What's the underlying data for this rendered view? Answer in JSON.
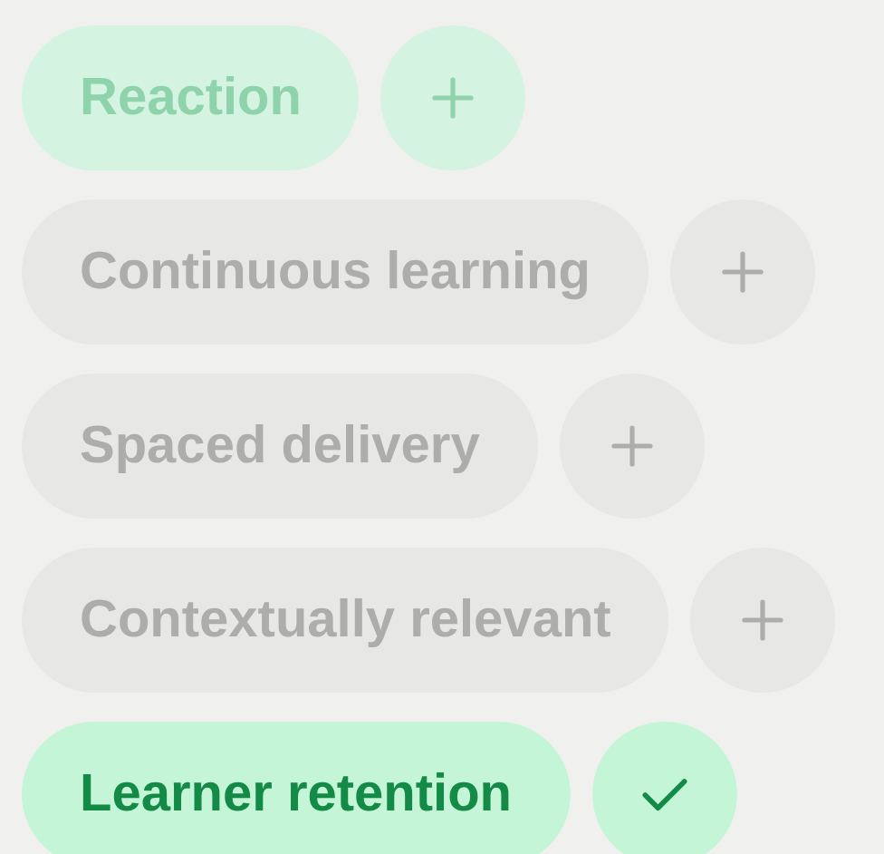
{
  "tags": [
    {
      "label": "Reaction",
      "kind": "fading"
    },
    {
      "label": "Continuous learning",
      "kind": "available"
    },
    {
      "label": "Spaced delivery",
      "kind": "available"
    },
    {
      "label": "Contextually relevant",
      "kind": "available"
    },
    {
      "label": "Learner retention",
      "kind": "added"
    }
  ]
}
